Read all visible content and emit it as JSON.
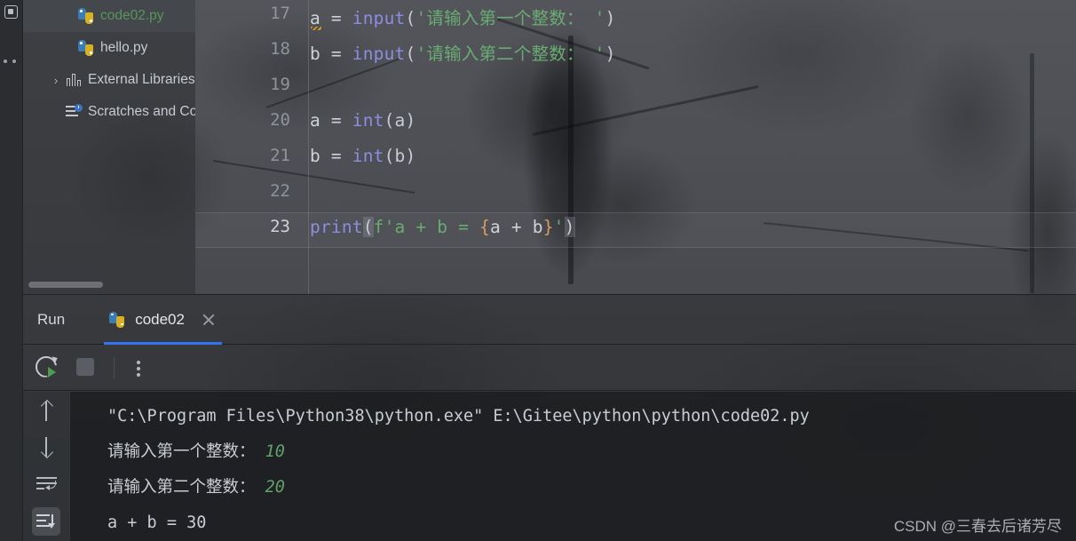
{
  "toolstrip": {
    "project_icon": "project-icon",
    "more_icon": "more-dots-icon"
  },
  "project_tree": {
    "items": [
      {
        "label": "code02.py",
        "icon": "python-file-icon",
        "selected": true,
        "indent": 1,
        "arrow": ""
      },
      {
        "label": "hello.py",
        "icon": "python-file-icon",
        "selected": false,
        "indent": 1,
        "arrow": ""
      },
      {
        "label": "External Libraries",
        "icon": "library-icon",
        "selected": false,
        "indent": 0,
        "arrow": "›"
      },
      {
        "label": "Scratches and Consoles",
        "icon": "scratches-icon",
        "selected": false,
        "indent": 1,
        "arrow": ""
      }
    ]
  },
  "editor": {
    "lines": [
      {
        "no": "17",
        "current": false
      },
      {
        "no": "18",
        "current": false
      },
      {
        "no": "19",
        "current": false
      },
      {
        "no": "20",
        "current": false
      },
      {
        "no": "21",
        "current": false
      },
      {
        "no": "22",
        "current": false
      },
      {
        "no": "23",
        "current": true
      }
    ],
    "code": {
      "l17_var": "a",
      "l17_eq": " = ",
      "l17_fn": "input",
      "l17_open": "(",
      "l17_str": "'请输入第一个整数： '",
      "l17_close": ")",
      "l18_var": "b",
      "l18_eq": " = ",
      "l18_fn": "input",
      "l18_open": "(",
      "l18_str": "'请输入第二个整数： '",
      "l18_close": ")",
      "l20_var": "a",
      "l20_eq": " = ",
      "l20_fn": "int",
      "l20_args": "(a)",
      "l21_var": "b",
      "l21_eq": " = ",
      "l21_fn": "int",
      "l21_args": "(b)",
      "l23_fn": "print",
      "l23_open": "(",
      "l23_str1": "f'a + b = ",
      "l23_brace_open": "{",
      "l23_expr": "a + b",
      "l23_brace_close": "}",
      "l23_str2": "'",
      "l23_close": ")"
    }
  },
  "run_window": {
    "title": "Run",
    "tab": {
      "label": "code02",
      "icon": "python-file-icon",
      "close_icon": "close-icon",
      "active": true,
      "accent": "#3574f0"
    },
    "toolbar": {
      "rerun_label": "rerun-icon",
      "stop_label": "stop-icon",
      "more_label": "more-options-icon"
    },
    "gutter": {
      "up_label": "arrow-up-icon",
      "down_label": "arrow-down-icon",
      "wrap_label": "soft-wrap-icon",
      "scroll_end_label": "scroll-to-end-icon"
    },
    "console": {
      "command": "\"C:\\Program Files\\Python38\\python.exe\" E:\\Gitee\\python\\python\\code02.py",
      "prompt1": "请输入第一个整数： ",
      "input1": "10",
      "prompt2": "请输入第二个整数： ",
      "input2": "20",
      "result": "a + b = 30"
    }
  },
  "watermark": {
    "text": "CSDN @三春去后诸芳尽"
  },
  "colors": {
    "accent": "#3574f0",
    "string": "#6aab73",
    "function": "#8d8ce0",
    "brace": "#d99b63",
    "default_text": "#cdd2d8",
    "console_value": "#5fa36a",
    "selected_file": "#57965c"
  }
}
